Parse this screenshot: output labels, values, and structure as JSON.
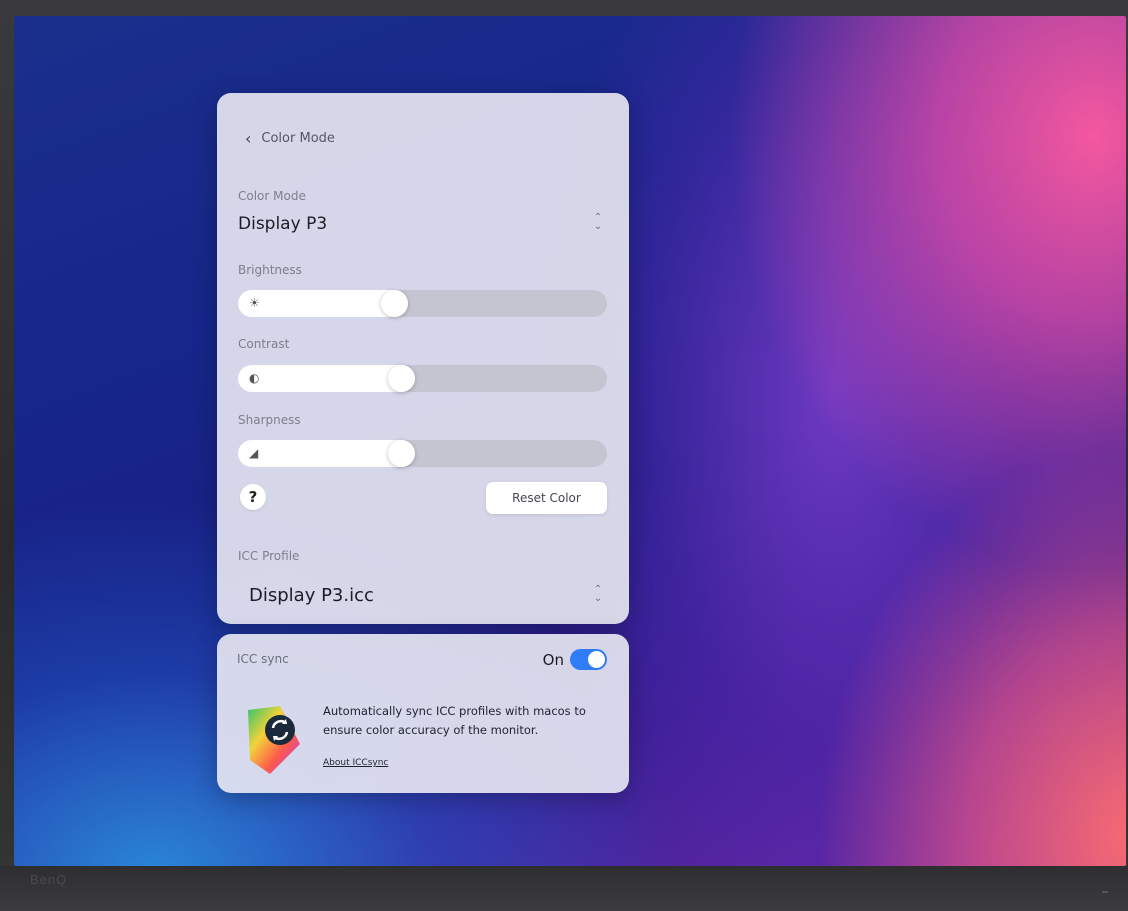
{
  "header": {
    "back_label": "Color Mode"
  },
  "color_mode": {
    "label": "Color Mode",
    "value": "Display P3"
  },
  "brightness": {
    "label": "Brightness",
    "level_fraction": 0.46
  },
  "contrast": {
    "label": "Contrast",
    "level_fraction": 0.48
  },
  "sharpness": {
    "label": "Sharpness",
    "level_fraction": 0.48
  },
  "actions": {
    "help_label": "?",
    "reset_label": "Reset Color"
  },
  "icc_profile": {
    "label": "ICC Profile",
    "value": "Display P3.icc"
  },
  "icc_sync": {
    "label": "ICC sync",
    "toggle_text": "On",
    "enabled": true,
    "description": "Automatically sync ICC profiles with macos to ensure color accuracy of the monitor.",
    "link_label": "About ICCsync"
  },
  "monitor": {
    "brand": "BenQ"
  },
  "colors": {
    "accent": "#2f7cf6",
    "panel": "#e4e4f0"
  }
}
